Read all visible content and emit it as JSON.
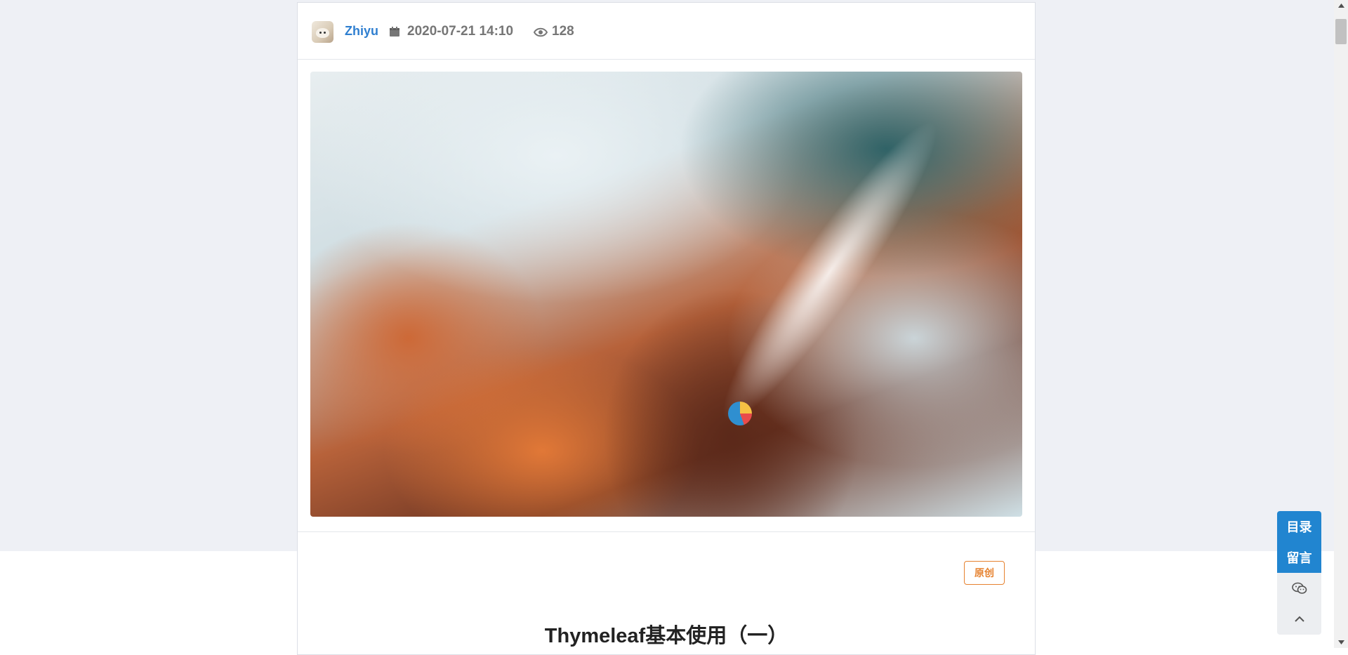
{
  "post": {
    "author": "Zhiyu",
    "date": "2020-07-21 14:10",
    "views": "128",
    "badge": "原创",
    "title": "Thymeleaf基本使用（一）"
  },
  "floating_toolbar": {
    "toc_label": "目录",
    "comment_label": "留言",
    "wechat_icon": "wechat-icon",
    "back_to_top_icon": "chevron-up-icon"
  },
  "colors": {
    "accent": "#2185d0",
    "author_link": "#2f7fd0",
    "badge": "#e6822f",
    "page_bg": "#eef0f5"
  }
}
